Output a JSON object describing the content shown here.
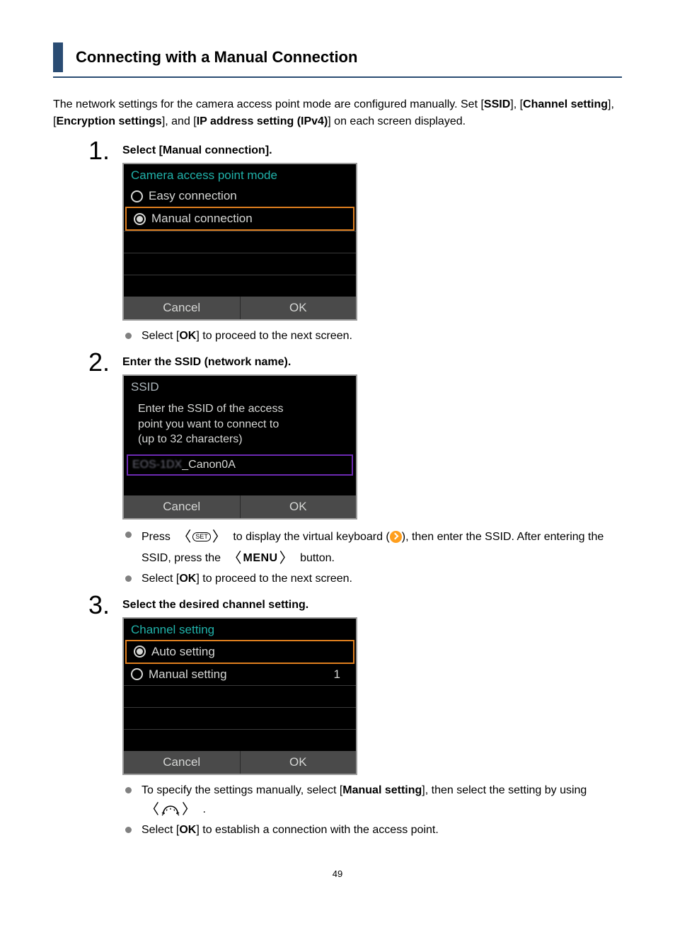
{
  "heading": "Connecting with a Manual Connection",
  "intro_parts": {
    "p1": "The network settings for the camera access point mode are configured manually. Set [",
    "b1": "SSID",
    "p2": "], [",
    "b2": "Channel setting",
    "p3": "], [",
    "b3": "Encryption settings",
    "p4": "], and [",
    "b4": "IP address setting (IPv4)",
    "p5": "] on each screen displayed."
  },
  "steps": [
    {
      "num": "1.",
      "title": "Select [Manual connection].",
      "screen": {
        "header": "Camera access point mode",
        "option1": "Easy connection",
        "option2": "Manual connection",
        "cancel": "Cancel",
        "ok": "OK"
      },
      "bullets": [
        {
          "pre": "Select [",
          "bold": "OK",
          "post": "] to proceed to the next screen."
        }
      ]
    },
    {
      "num": "2.",
      "title": "Enter the SSID (network name).",
      "screen": {
        "header": "SSID",
        "msg1": "Enter the SSID of the access",
        "msg2": "point you want to connect to",
        "msg3": "(up to 32 characters)",
        "input_prefix": "EOS-1DX",
        "input_value": "_Canon0A",
        "cancel": "Cancel",
        "ok": "OK"
      },
      "bullets_b1": {
        "pre": "Press ",
        "mid": " to display the virtual keyboard (",
        "post1": "), then enter the SSID. After entering the SSID, press the ",
        "post2": " button."
      },
      "bullets_b2": {
        "pre": "Select [",
        "bold": "OK",
        "post": "] to proceed to the next screen."
      },
      "menu_label": "MENU"
    },
    {
      "num": "3.",
      "title": "Select the desired channel setting.",
      "screen": {
        "header": "Channel setting",
        "option1": "Auto setting",
        "option2": "Manual setting",
        "option2_value": "1",
        "cancel": "Cancel",
        "ok": "OK"
      },
      "bullets_b1": {
        "pre": "To specify the settings manually, select [",
        "bold": "Manual setting",
        "mid": "], then select the setting by using ",
        "post": "."
      },
      "bullets_b2": {
        "pre": "Select [",
        "bold": "OK",
        "post": "] to establish a connection with the access point."
      }
    }
  ],
  "page_number": "49",
  "icons": {
    "set": "SET"
  }
}
